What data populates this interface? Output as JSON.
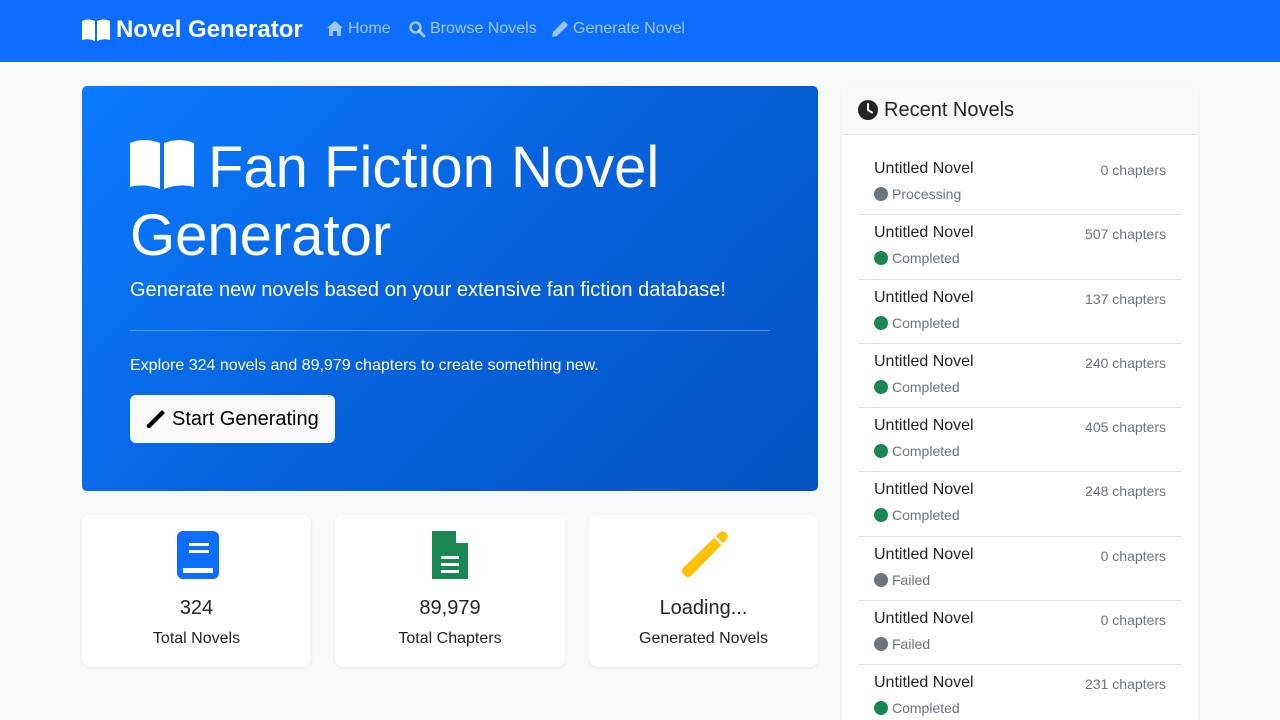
{
  "navbar": {
    "brand": "Novel Generator",
    "links": [
      {
        "label": "Home",
        "icon": "home-icon"
      },
      {
        "label": "Browse Novels",
        "icon": "search-icon"
      },
      {
        "label": "Generate Novel",
        "icon": "pencil-icon"
      }
    ]
  },
  "hero": {
    "title": "Fan Fiction Novel Generator",
    "subtitle": "Generate new novels based on your extensive fan fiction database!",
    "explore_text": "Explore 324 novels and 89,979 chapters to create something new.",
    "button_label": "Start Generating"
  },
  "stats": [
    {
      "value": "324",
      "label": "Total Novels",
      "icon": "book-icon",
      "color": "#0d6efd"
    },
    {
      "value": "89,979",
      "label": "Total Chapters",
      "icon": "file-text-icon",
      "color": "#198754"
    },
    {
      "value": "Loading...",
      "label": "Generated Novels",
      "icon": "magic-wand-icon",
      "color": "#ffc107"
    }
  ],
  "recent": {
    "title": "Recent Novels",
    "items": [
      {
        "title": "Untitled Novel",
        "chapters": "0 chapters",
        "status": "Processing",
        "status_color": "#6c757d"
      },
      {
        "title": "Untitled Novel",
        "chapters": "507 chapters",
        "status": "Completed",
        "status_color": "#198754"
      },
      {
        "title": "Untitled Novel",
        "chapters": "137 chapters",
        "status": "Completed",
        "status_color": "#198754"
      },
      {
        "title": "Untitled Novel",
        "chapters": "240 chapters",
        "status": "Completed",
        "status_color": "#198754"
      },
      {
        "title": "Untitled Novel",
        "chapters": "405 chapters",
        "status": "Completed",
        "status_color": "#198754"
      },
      {
        "title": "Untitled Novel",
        "chapters": "248 chapters",
        "status": "Completed",
        "status_color": "#198754"
      },
      {
        "title": "Untitled Novel",
        "chapters": "0 chapters",
        "status": "Failed",
        "status_color": "#6c757d"
      },
      {
        "title": "Untitled Novel",
        "chapters": "0 chapters",
        "status": "Failed",
        "status_color": "#6c757d"
      },
      {
        "title": "Untitled Novel",
        "chapters": "231 chapters",
        "status": "Completed",
        "status_color": "#198754"
      }
    ]
  },
  "colors": {
    "primary": "#0d6efd",
    "success": "#198754",
    "warning": "#ffc107",
    "muted": "#6c757d"
  }
}
